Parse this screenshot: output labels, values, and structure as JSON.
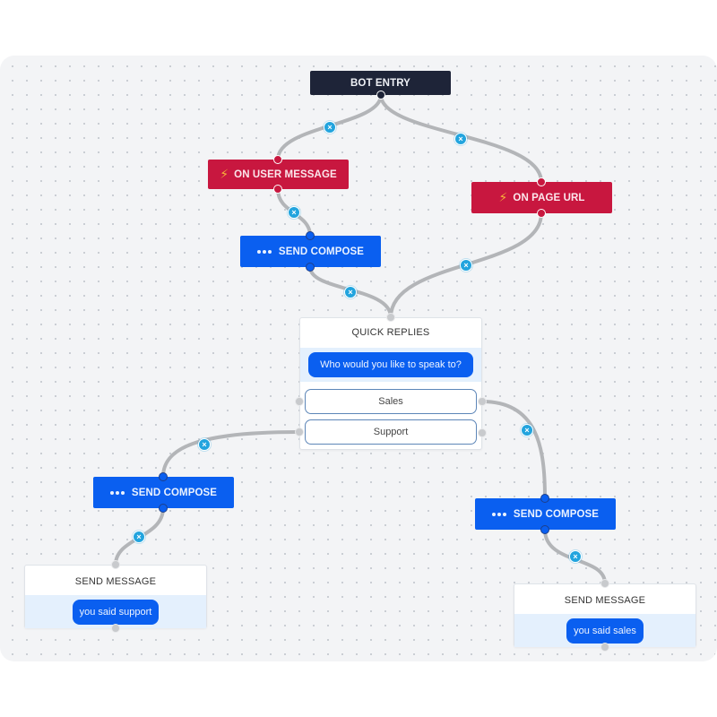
{
  "colors": {
    "entry": "#1e2438",
    "trigger": "#c8173f",
    "action": "#0a5ff0",
    "edge": "#b3b5b8",
    "delete_badge": "#22a4de",
    "canvas": "#f3f4f6"
  },
  "icons": {
    "trigger_icon": "lightning-bolt-icon",
    "compose_icon": "typing-dots-icon",
    "delete_edge_icon": "close-x-icon"
  },
  "nodes": {
    "bot_entry": {
      "label": "BOT ENTRY"
    },
    "on_user_message": {
      "label": "ON USER MESSAGE",
      "icon": "⚡"
    },
    "on_page_url": {
      "label": "ON PAGE URL",
      "icon": "⚡"
    },
    "send_compose_1": {
      "label": "SEND COMPOSE"
    },
    "quick_replies": {
      "title": "QUICK REPLIES",
      "message": "Who would you like to speak to?",
      "options": [
        "Sales",
        "Support"
      ]
    },
    "send_compose_2": {
      "label": "SEND COMPOSE"
    },
    "send_compose_3": {
      "label": "SEND COMPOSE"
    },
    "send_message_support": {
      "title": "SEND MESSAGE",
      "message": "you said support"
    },
    "send_message_sales": {
      "title": "SEND MESSAGE",
      "message": "you said sales"
    }
  },
  "edges": [
    {
      "from": "bot_entry",
      "to": "on_user_message"
    },
    {
      "from": "bot_entry",
      "to": "on_page_url"
    },
    {
      "from": "on_user_message",
      "to": "send_compose_1"
    },
    {
      "from": "send_compose_1",
      "to": "quick_replies"
    },
    {
      "from": "on_page_url",
      "to": "quick_replies"
    },
    {
      "from": "quick_replies.Support",
      "to": "send_compose_2"
    },
    {
      "from": "quick_replies.Sales",
      "to": "send_compose_3"
    },
    {
      "from": "send_compose_2",
      "to": "send_message_support"
    },
    {
      "from": "send_compose_3",
      "to": "send_message_sales"
    }
  ],
  "delete_badge_glyph": "×"
}
